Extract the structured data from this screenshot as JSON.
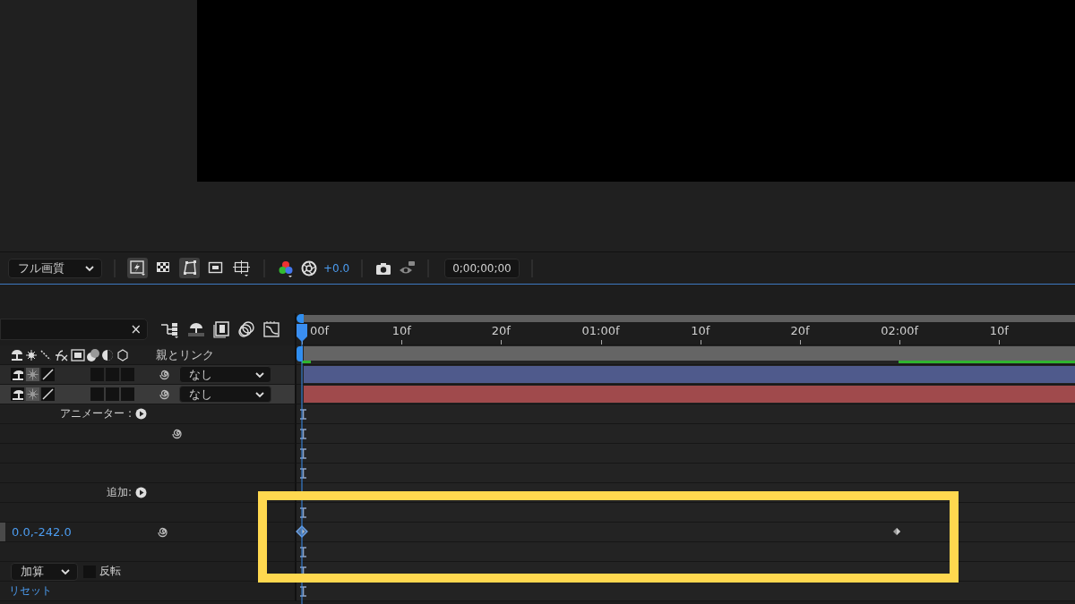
{
  "toolbar": {
    "quality": "フル画質",
    "toggles": [
      {
        "kind": "preview",
        "selected": true
      },
      {
        "kind": "grid",
        "selected": false
      },
      {
        "kind": "mask",
        "selected": true
      },
      {
        "kind": "region",
        "selected": false
      },
      {
        "kind": "guides",
        "selected": false
      }
    ],
    "exposure": "+0.0",
    "timecode": "0;00;00;00"
  },
  "search": {
    "clear": "×"
  },
  "columns": {
    "parent_link": "親とリンク"
  },
  "ruler": {
    "ticks": [
      "00f",
      "10f",
      "20f",
      "01:00f",
      "10f",
      "20f",
      "02:00f",
      "10f"
    ]
  },
  "layers": [
    {
      "parent": "なし",
      "color": "#4f5a8c",
      "selected": false
    },
    {
      "parent": "なし",
      "color": "#a04a4c",
      "selected": true
    }
  ],
  "properties": [
    {
      "kind": "label",
      "text": "アニメーター :",
      "marker": true
    },
    {
      "kind": "link",
      "marker": true
    },
    {
      "kind": "empty",
      "marker": true
    },
    {
      "kind": "empty",
      "marker": true
    },
    {
      "kind": "label",
      "text": "追加:",
      "marker": false
    },
    {
      "kind": "empty",
      "marker": true
    },
    {
      "kind": "value",
      "value": "0.0,-242.0",
      "marker": false,
      "keyframes": [
        {
          "level": 0,
          "selected": true
        },
        {
          "level": 0.777,
          "selected": false
        }
      ]
    },
    {
      "kind": "empty",
      "marker": true
    },
    {
      "kind": "mode",
      "mode": "加算",
      "invert_label": "反転",
      "invert": false,
      "marker": true
    },
    {
      "kind": "reset",
      "text": "リセット",
      "marker": true
    }
  ]
}
